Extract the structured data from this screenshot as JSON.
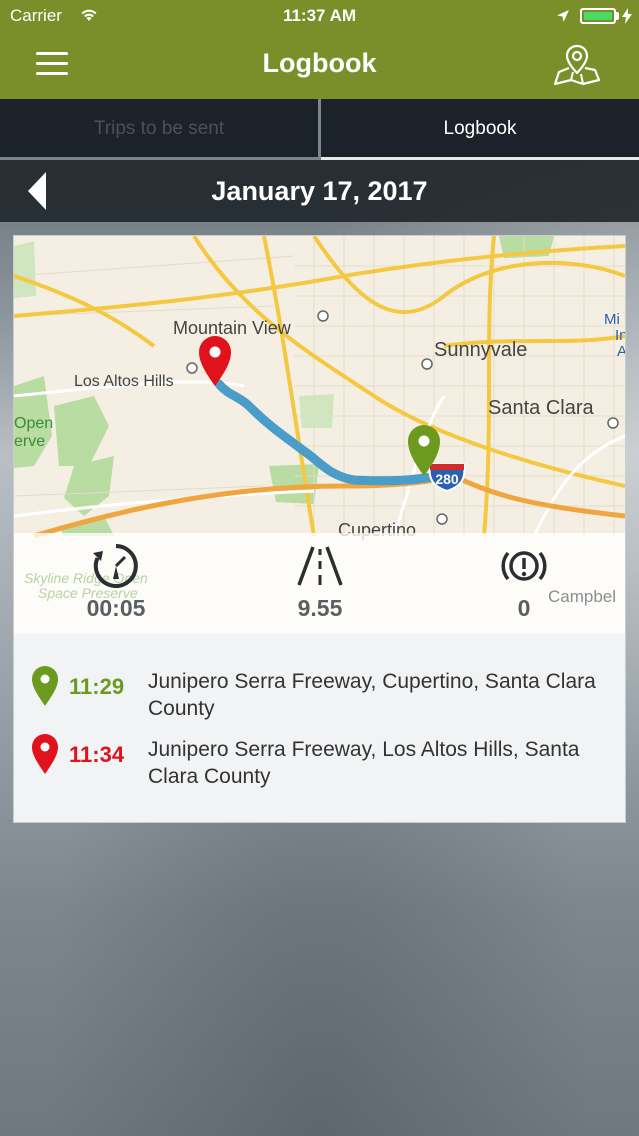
{
  "status_bar": {
    "carrier": "Carrier",
    "time": "11:37 AM"
  },
  "header": {
    "title": "Logbook",
    "menu_icon": "hamburger-menu-icon",
    "right_icon": "map-pin-icon"
  },
  "tabs": [
    {
      "label": "Trips to be sent",
      "active": false
    },
    {
      "label": "Logbook",
      "active": true
    }
  ],
  "date_bar": {
    "date": "January 17, 2017",
    "back_icon": "chevron-left-icon"
  },
  "map": {
    "labels": {
      "mountain_view": "Mountain View",
      "los_altos_hills": "Los Altos Hills",
      "sunnyvale": "Sunnyvale",
      "santa_clara": "Santa Clara",
      "cupertino": "Cupertino",
      "open_reserve_a": "Open",
      "open_reserve_b": "erve",
      "skyline": "Skyline Ridge Open",
      "skyline_b": "Space Preserve",
      "campbell": "Campbel",
      "mi": "Mi",
      "in": "In",
      "a": "A",
      "highway": "280"
    }
  },
  "stats": {
    "duration": "00:05",
    "distance": "9.55",
    "events": "0"
  },
  "stops": [
    {
      "time": "11:29",
      "address": "Junipero Serra Freeway, Cupertino, Santa Clara County",
      "color": "#6b9a1f"
    },
    {
      "time": "11:34",
      "address": "Junipero Serra Freeway, Los Altos Hills, Santa Clara County",
      "color": "#e0121b"
    }
  ],
  "colors": {
    "header": "#7a8f2a",
    "tabs_bg": "#1c2229",
    "route": "#4a9cc9",
    "start_pin": "#6b9a1f",
    "end_pin": "#e0121b"
  }
}
